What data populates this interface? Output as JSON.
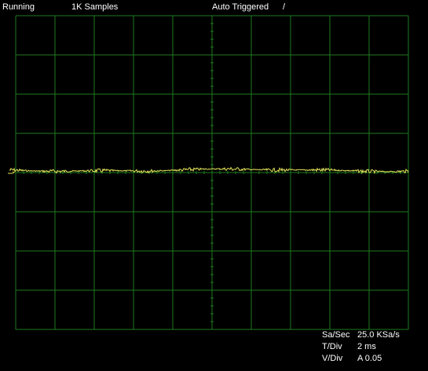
{
  "status": {
    "run_state": "Running",
    "samples": "1K Samples",
    "trigger_mode": "Auto Triggered",
    "trigger_slope_glyph": "/"
  },
  "readout": {
    "sample_rate_label": "Sa/Sec",
    "sample_rate_value": "25.0 KSa/s",
    "time_div_label": "T/Div",
    "time_div_value": "2 ms",
    "volt_div_label": "V/Div",
    "volt_div_value": "A 0.05"
  },
  "colors": {
    "background": "#000000",
    "grid": "#1f7a1f",
    "trace": "#e6e65a",
    "text": "#ffffff"
  },
  "display": {
    "horizontal_divisions": 10,
    "vertical_divisions": 8,
    "trace_level_divisions": 0.06,
    "noise_amplitude_divisions": 0.05
  },
  "icons": {
    "trigger_slope": "rising-edge-icon",
    "trigger_marker": "trigger-level-arrow-icon"
  }
}
